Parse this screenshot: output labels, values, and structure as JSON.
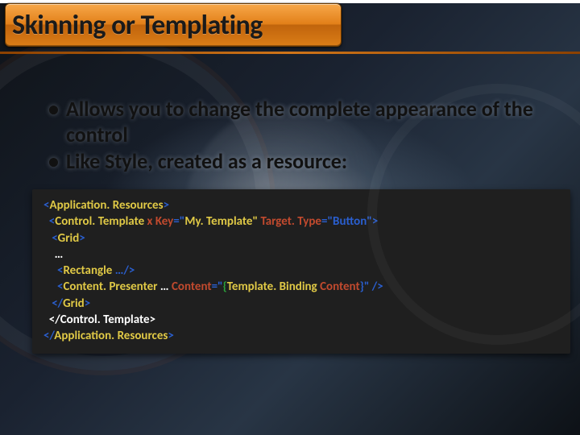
{
  "slide": {
    "title": "Skinning or Templating",
    "bullets": [
      "Allows you to change the complete appearance of the control",
      "Like Style, created as a resource:"
    ],
    "code": {
      "l1": {
        "open": "<",
        "tag": "Application. Resources",
        "close": ">"
      },
      "l2": {
        "open": "<",
        "tag": "Control. Template",
        "attr1k": " x Key",
        "eq1": "=\"",
        "attr1v": "My. Template\"",
        "attr2k": " Target. Type",
        "eq2": "=",
        "attr2v": "\"Button\">"
      },
      "l3": {
        "open": "<",
        "tag": "Grid",
        "close": ">"
      },
      "l4": {
        "dots": "…"
      },
      "l5": {
        "open": "<",
        "tag": "Rectangle",
        "rest": " …/>"
      },
      "l6": {
        "open": "<",
        "tag": "Content. Presenter",
        "dots": " … ",
        "attrk": "Content",
        "eq": "=\"",
        "bindopen": "{",
        "bindbody": "Template. Binding ",
        "bindprop": "Content",
        "bindclose": "}\"",
        "end": " />"
      },
      "l7": {
        "open": "</",
        "tag": "Grid",
        "close": ">"
      },
      "l8": {
        "text": "</Control. Template>"
      },
      "l9": {
        "open": "</",
        "tag": "Application. Resources",
        "close": ">"
      }
    }
  }
}
